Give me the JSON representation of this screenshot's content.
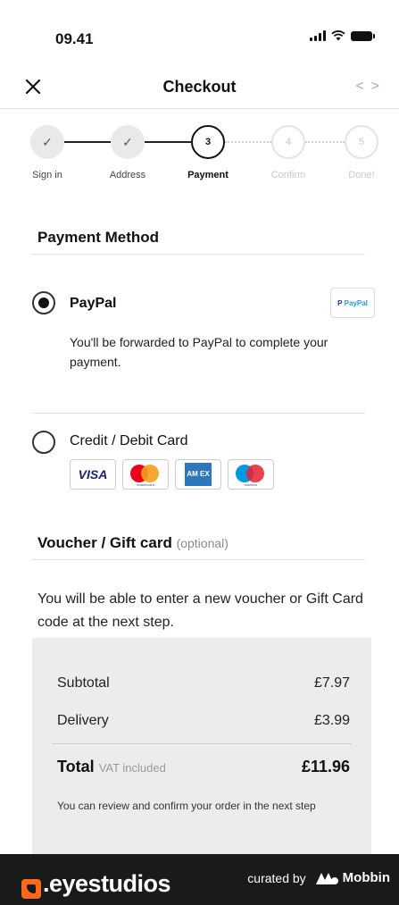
{
  "status_bar": {
    "time": "09.41"
  },
  "nav": {
    "title": "Checkout",
    "prev_label": "<",
    "next_label": ">"
  },
  "stepper": {
    "steps": [
      {
        "label": "Sign in",
        "marker": "✓",
        "state": "done"
      },
      {
        "label": "Address",
        "marker": "✓",
        "state": "done"
      },
      {
        "label": "Payment",
        "marker": "3",
        "state": "active"
      },
      {
        "label": "Confirm",
        "marker": "4",
        "state": "todo"
      },
      {
        "label": "Done!",
        "marker": "5",
        "state": "todo"
      }
    ]
  },
  "payment": {
    "title": "Payment Method",
    "paypal": {
      "label": "PayPal",
      "selected": true,
      "description": "You'll be forwarded to PayPal to complete your payment.",
      "badge_prefix": "P",
      "badge_text": "PayPal"
    },
    "card": {
      "label": "Credit / Debit Card",
      "selected": false,
      "logos": [
        {
          "name": "visa-logo",
          "text": "VISA"
        },
        {
          "name": "mastercard-logo",
          "text": "mastercard"
        },
        {
          "name": "amex-logo",
          "text": "AM EX"
        },
        {
          "name": "maestro-logo",
          "text": "maestro"
        }
      ]
    }
  },
  "voucher": {
    "title": "Voucher / Gift card",
    "optional": "(optional)",
    "text": "You will be able to enter a new voucher or Gift Card code at the next step."
  },
  "summary": {
    "subtotal_label": "Subtotal",
    "subtotal_value": "£7.97",
    "delivery_label": "Delivery",
    "delivery_value": "£3.99",
    "total_label": "Total",
    "vat_label": "VAT included",
    "total_value": "£11.96",
    "note": "You can review and confirm your order in the next step"
  },
  "footer": {
    "brand": ".eyestudios",
    "curated_by": "curated by",
    "mobbin": "Mobbin"
  },
  "colors": {
    "accent": "#111111",
    "summary_bg": "#ececec",
    "footer_bg": "#1a1a1a",
    "brand_orange": "#ff6a1a"
  }
}
